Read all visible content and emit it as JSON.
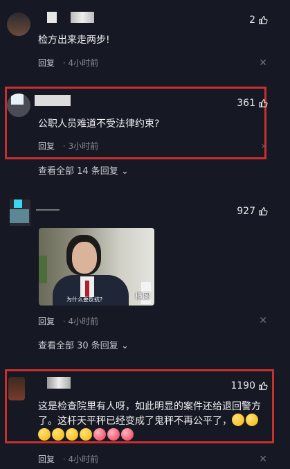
{
  "comments": [
    {
      "text": "检方出来走两步!",
      "likes": "2",
      "reply_label": "回复",
      "time": "4小时前"
    },
    {
      "text": "公职人员难道不受法律约束?",
      "likes": "361",
      "reply_label": "回复",
      "time": "3小时前",
      "view_all": "查看全部 14 条回复"
    },
    {
      "likes": "927",
      "image_tag": "横图",
      "image_caption": "为什么要反抗?",
      "reply_label": "回复",
      "time": "4小时前",
      "view_all": "查看全部 30 条回复"
    },
    {
      "text": "这是检查院里有人呀，如此明显的案件还给退回警方了。这杆天平秤已经变成了鬼秤不再公平了，",
      "likes": "1190",
      "reply_label": "回复",
      "time": "4小时前"
    }
  ],
  "colors": {
    "background": "#161823",
    "highlight": "#c9302c"
  }
}
